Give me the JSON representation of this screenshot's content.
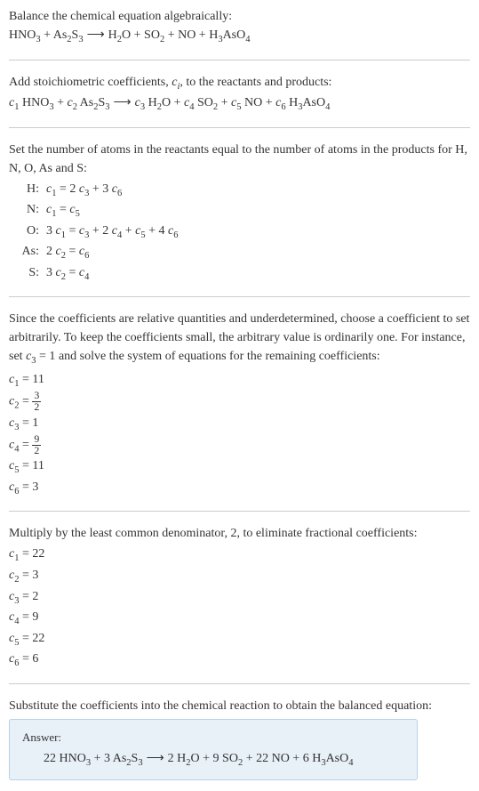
{
  "step1": {
    "text": "Balance the chemical equation algebraically:",
    "equation": "HNO₃ + As₂S₃  ⟶  H₂O + SO₂ + NO + H₃AsO₄"
  },
  "step2": {
    "text_part1": "Add stoichiometric coefficients, ",
    "ci": "cᵢ",
    "text_part2": ", to the reactants and products:",
    "equation": "c₁ HNO₃ + c₂ As₂S₃  ⟶  c₃ H₂O + c₄ SO₂ + c₅ NO + c₆ H₃AsO₄"
  },
  "step3": {
    "text": "Set the number of atoms in the reactants equal to the number of atoms in the products for H, N, O, As and S:",
    "rows": [
      {
        "label": "H:",
        "eq": "c₁ = 2 c₃ + 3 c₆"
      },
      {
        "label": "N:",
        "eq": "c₁ = c₅"
      },
      {
        "label": "O:",
        "eq": "3 c₁ = c₃ + 2 c₄ + c₅ + 4 c₆"
      },
      {
        "label": "As:",
        "eq": "2 c₂ = c₆"
      },
      {
        "label": "S:",
        "eq": "3 c₂ = c₄"
      }
    ]
  },
  "step4": {
    "text_part1": "Since the coefficients are relative quantities and underdetermined, choose a coefficient to set arbitrarily. To keep the coefficients small, the arbitrary value is ordinarily one. For instance, set ",
    "c3eq1": "c₃ = 1",
    "text_part2": " and solve the system of equations for the remaining coefficients:",
    "coeffs": [
      {
        "var": "c₁",
        "val": "11",
        "frac": null
      },
      {
        "var": "c₂",
        "val": null,
        "frac": {
          "num": "3",
          "den": "2"
        }
      },
      {
        "var": "c₃",
        "val": "1",
        "frac": null
      },
      {
        "var": "c₄",
        "val": null,
        "frac": {
          "num": "9",
          "den": "2"
        }
      },
      {
        "var": "c₅",
        "val": "11",
        "frac": null
      },
      {
        "var": "c₆",
        "val": "3",
        "frac": null
      }
    ]
  },
  "step5": {
    "text": "Multiply by the least common denominator, 2, to eliminate fractional coefficients:",
    "coeffs": [
      {
        "var": "c₁",
        "val": "22"
      },
      {
        "var": "c₂",
        "val": "3"
      },
      {
        "var": "c₃",
        "val": "2"
      },
      {
        "var": "c₄",
        "val": "9"
      },
      {
        "var": "c₅",
        "val": "22"
      },
      {
        "var": "c₆",
        "val": "6"
      }
    ]
  },
  "step6": {
    "text": "Substitute the coefficients into the chemical reaction to obtain the balanced equation:"
  },
  "answer": {
    "label": "Answer:",
    "equation": "22 HNO₃ + 3 As₂S₃  ⟶  2 H₂O + 9 SO₂ + 22 NO + 6 H₃AsO₄"
  }
}
